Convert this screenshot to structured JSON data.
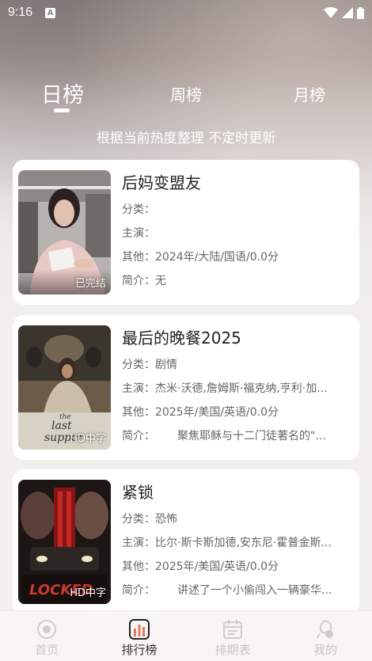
{
  "status": {
    "time": "9:16",
    "notif": "A"
  },
  "tabs": [
    {
      "label": "日榜",
      "active": true
    },
    {
      "label": "周榜",
      "active": false
    },
    {
      "label": "月榜",
      "active": false
    }
  ],
  "subtitle": "根据当前热度整理 不定时更新",
  "labels": {
    "category": "分类：",
    "cast": "主演：",
    "other": "其他：",
    "intro": "简介："
  },
  "items": [
    {
      "title": "后妈变盟友",
      "category": "",
      "cast": "",
      "other": "2024年/大陆/国语/0.0分",
      "intro": "无",
      "badge": "已完结"
    },
    {
      "title": "最后的晚餐2025",
      "category": "剧情",
      "cast": "杰米·沃德,詹姆斯·福克纳,亨利·加...",
      "other": "2025年/美国/英语/0.0分",
      "intro": "聚焦耶稣与十二门徒著名的\"...",
      "badge": "HD中字",
      "poster_text": "the last supper"
    },
    {
      "title": "紧锁",
      "category": "恐怖",
      "cast": "比尔·斯卡斯加德,安东尼·霍普金斯...",
      "other": "2025年/美国/英语/0.0分",
      "intro": "讲述了一个小偷闯入一辆豪华...",
      "badge": "HD中字",
      "poster_text": "LOCKED"
    }
  ],
  "nav": [
    {
      "label": "首页",
      "icon": "home-icon",
      "active": false
    },
    {
      "label": "排行榜",
      "icon": "ranking-icon",
      "active": true
    },
    {
      "label": "排期表",
      "icon": "calendar-icon",
      "active": false
    },
    {
      "label": "我的",
      "icon": "profile-icon",
      "active": false
    }
  ],
  "colors": {
    "accent": "#e07a5f",
    "inactive": "#c8c6c4",
    "text": "#222222"
  }
}
